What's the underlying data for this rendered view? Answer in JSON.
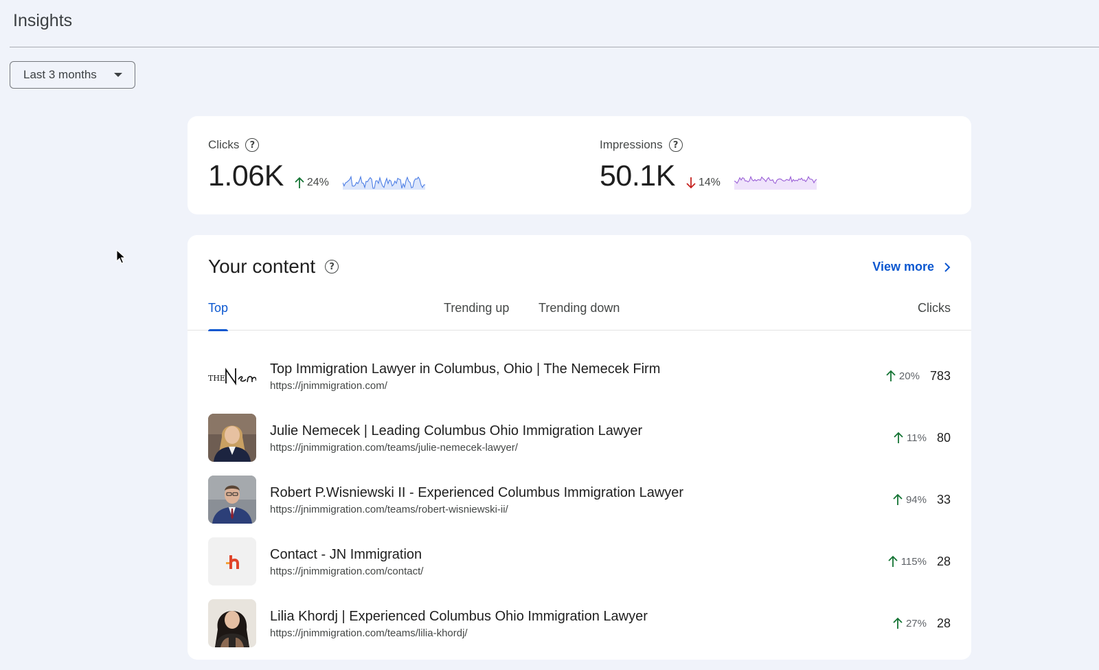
{
  "header": {
    "title": "Insights"
  },
  "filter": {
    "range_label": "Last 3 months"
  },
  "metrics": [
    {
      "label": "Clicks",
      "value": "1.06K",
      "change": "24%",
      "direction": "up",
      "spark_color": "#4d7ee5"
    },
    {
      "label": "Impressions",
      "value": "50.1K",
      "change": "14%",
      "direction": "down",
      "spark_color": "#9a5fd6"
    }
  ],
  "content": {
    "title": "Your content",
    "view_more": "View more",
    "tabs": [
      {
        "label": "Top",
        "active": true
      },
      {
        "label": "Trending up",
        "active": false
      },
      {
        "label": "Trending down",
        "active": false
      }
    ],
    "clicks_header": "Clicks",
    "rows": [
      {
        "title": "Top Immigration Lawyer in Columbus, Ohio | The Nemecek Firm",
        "url": "https://jnimmigration.com/",
        "change": "20%",
        "clicks": "783",
        "thumb": "logo-nemecek"
      },
      {
        "title": "Julie Nemecek | Leading Columbus Ohio Immigration Lawyer",
        "url": "https://jnimmigration.com/teams/julie-nemecek-lawyer/",
        "change": "11%",
        "clicks": "80",
        "thumb": "portrait-woman-blonde"
      },
      {
        "title": "Robert P.Wisniewski II - Experienced Columbus Immigration Lawyer",
        "url": "https://jnimmigration.com/teams/robert-wisniewski-ii/",
        "change": "94%",
        "clicks": "33",
        "thumb": "portrait-man-suit"
      },
      {
        "title": "Contact - JN Immigration",
        "url": "https://jnimmigration.com/contact/",
        "change": "115%",
        "clicks": "28",
        "thumb": "favicon-jn"
      },
      {
        "title": "Lilia Khordj | Experienced Columbus Ohio Immigration Lawyer",
        "url": "https://jnimmigration.com/teams/lilia-khordj/",
        "change": "27%",
        "clicks": "28",
        "thumb": "portrait-woman-dark-hair"
      }
    ]
  },
  "colors": {
    "accent": "#0b57d0",
    "up": "#137333",
    "down": "#c5221f"
  }
}
